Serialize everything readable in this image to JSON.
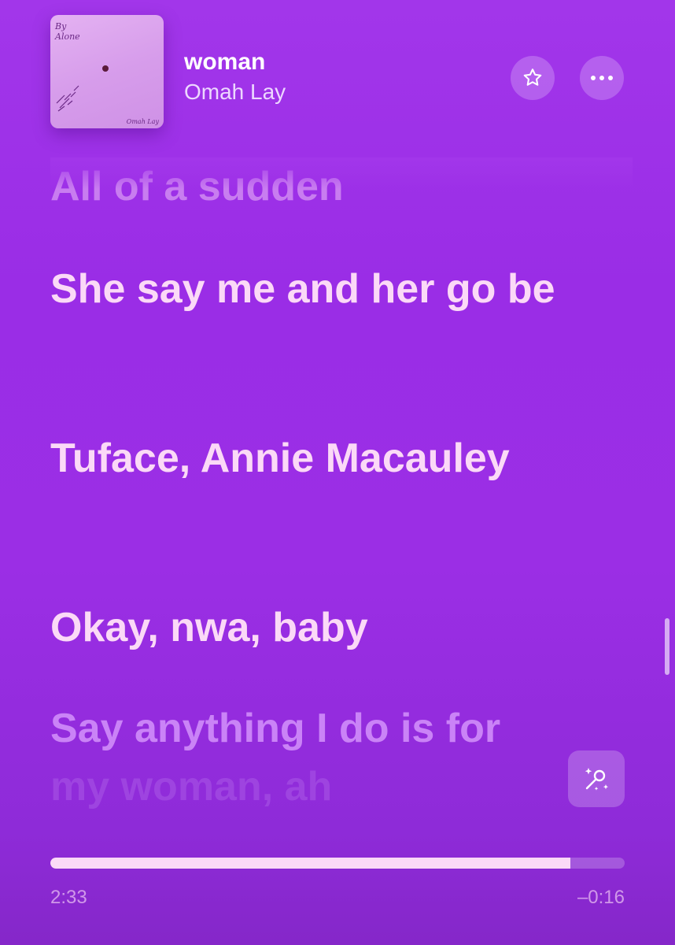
{
  "now_playing": {
    "title": "woman",
    "artist": "Omah Lay",
    "album_art": {
      "signature_top": "By Alone",
      "signature_bottom": "Omah Lay"
    }
  },
  "actions": {
    "favorite_icon": "star-icon",
    "more_icon": "ellipsis-icon",
    "karaoke_icon": "microphone-sparkle-icon"
  },
  "lyrics": [
    "All of a sudden",
    "She say me and her go be",
    "Tuface, Annie Macauley",
    "Okay, nwa, baby",
    "Say anything I do is for my woman, ah"
  ],
  "lyrics_display": {
    "line5_first": "Say anything I do is for",
    "line5_second": "my woman, ah"
  },
  "playback": {
    "elapsed": "2:33",
    "remaining": "–0:16",
    "progress_fraction": 0.905
  },
  "colors": {
    "background_top": "#a236ea",
    "background_bottom": "#8527c9",
    "lyric_active": "#fbd9f7",
    "progress_fill": "#fbd9f7"
  }
}
